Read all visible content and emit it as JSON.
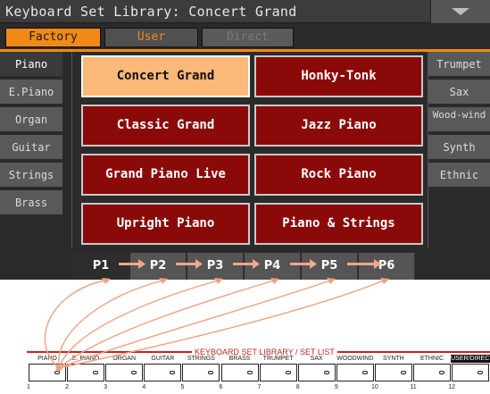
{
  "title": "Keyboard Set Library: Concert Grand",
  "tabs": [
    "Factory",
    "User",
    "Direct"
  ],
  "left_categories": [
    "Piano",
    "E.Piano",
    "Organ",
    "Guitar",
    "Strings",
    "Brass"
  ],
  "right_categories": [
    "Trumpet",
    "Sax",
    "Wood-wind",
    "Synth",
    "Ethnic"
  ],
  "presets": [
    "Concert Grand",
    "Honky-Tonk",
    "Classic Grand",
    "Jazz Piano",
    "Grand Piano Live",
    "Rock Piano",
    "Upright Piano",
    "Piano & Strings"
  ],
  "pages": [
    "P1",
    "P2",
    "P3",
    "P4",
    "P5",
    "P6"
  ],
  "panel": {
    "title": "KEYBOARD SET LIBRARY / SET LIST",
    "buttons": [
      "PIANO",
      "E. PIANO",
      "ORGAN",
      "GUITAR",
      "STRINGS",
      "BRASS",
      "TRUMPET",
      "SAX",
      "WOODWIND",
      "SYNTH",
      "ETHNIC",
      "USER/DIRECT"
    ],
    "numbers": [
      "1",
      "2",
      "3",
      "4",
      "5",
      "6",
      "7",
      "8",
      "9",
      "10",
      "11",
      "12"
    ]
  },
  "colors": {
    "accent": "#f08a17",
    "preset": "#8a0a0a",
    "selected": "#fab879",
    "panel_line": "#cc1f1f"
  }
}
